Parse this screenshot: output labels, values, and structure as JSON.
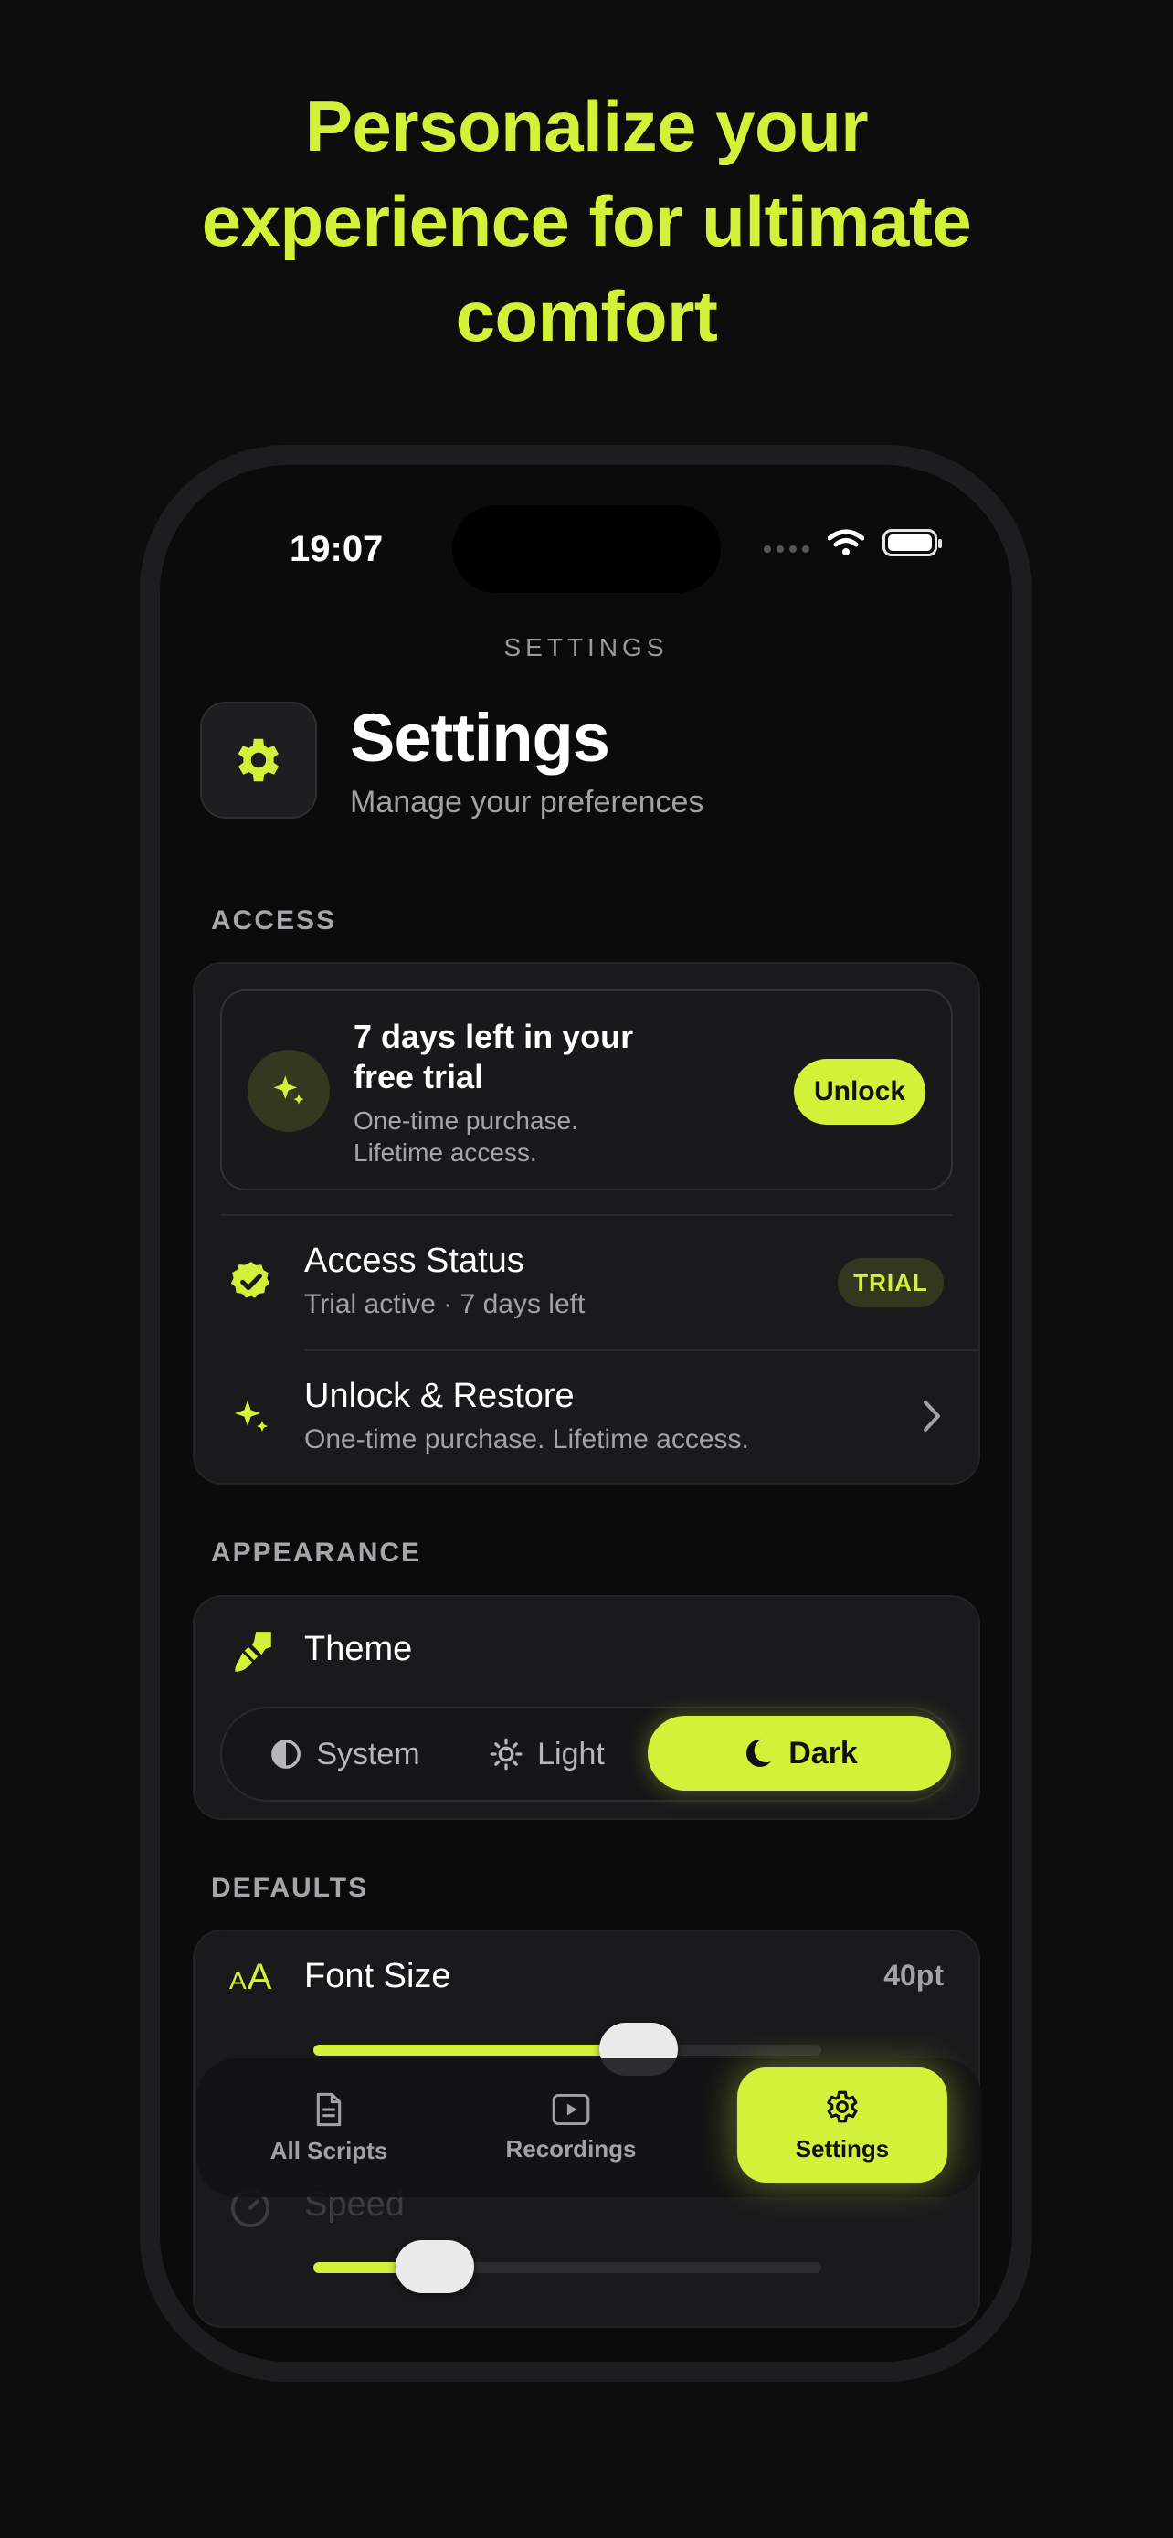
{
  "headline": "Personalize your experience for ultimate comfort",
  "status_bar": {
    "time": "19:07"
  },
  "nav": {
    "caption": "SETTINGS"
  },
  "header": {
    "title": "Settings",
    "subtitle": "Manage your preferences"
  },
  "access": {
    "label": "ACCESS",
    "trial": {
      "title": "7 days left in your free trial",
      "subtitle": "One-time purchase. Lifetime access.",
      "button": "Unlock"
    },
    "status": {
      "title": "Access Status",
      "subtitle": "Trial active · 7 days left",
      "badge": "TRIAL"
    },
    "unlock": {
      "title": "Unlock & Restore",
      "subtitle": "One-time purchase. Lifetime access."
    }
  },
  "appearance": {
    "label": "APPEARANCE",
    "theme_label": "Theme",
    "options": [
      "System",
      "Light",
      "Dark"
    ],
    "selected": "Dark"
  },
  "defaults": {
    "label": "DEFAULTS",
    "font_size": {
      "title": "Font Size",
      "value": "40pt",
      "fraction": 0.64
    },
    "speed": {
      "title": "Speed",
      "fraction": 0.24
    }
  },
  "tabbar": {
    "tabs": [
      {
        "label": "All Scripts",
        "icon": "document-icon"
      },
      {
        "label": "Recordings",
        "icon": "play-icon"
      },
      {
        "label": "Settings",
        "icon": "gear-icon"
      }
    ],
    "selected": "Settings"
  },
  "colors": {
    "accent": "#d2f23a",
    "background": "#0b0b0c",
    "card": "#1a1a1c"
  }
}
